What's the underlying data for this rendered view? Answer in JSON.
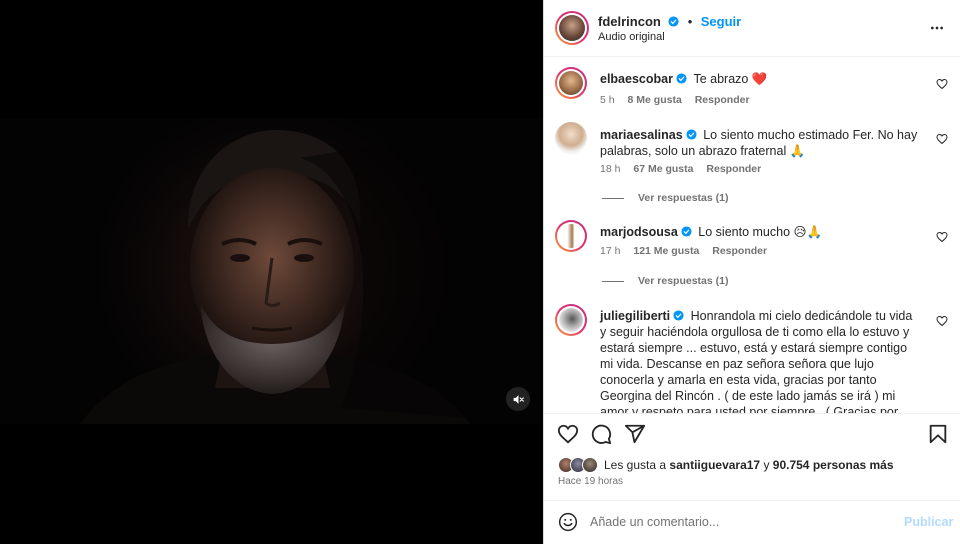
{
  "post": {
    "username": "fdelrincon",
    "separator": "•",
    "follow_label": "Seguir",
    "audio": "Audio original"
  },
  "comments": [
    {
      "username": "elbaescobar",
      "text": "Te abrazo ❤️",
      "time": "5 h",
      "likes": "8 Me gusta",
      "reply": "Responder"
    },
    {
      "username": "mariaesalinas",
      "text": "Lo siento mucho estimado Fer. No hay palabras, solo un abrazo fraternal 🙏",
      "time": "18 h",
      "likes": "67 Me gusta",
      "reply": "Responder",
      "view_replies": "Ver respuestas (1)"
    },
    {
      "username": "marjodsousa",
      "text": "Lo siento mucho 😥🙏",
      "time": "17 h",
      "likes": "121 Me gusta",
      "reply": "Responder",
      "view_replies": "Ver respuestas (1)"
    },
    {
      "username": "juliegiliberti",
      "text": "Honrandola mi cielo dedicándole tu vida y seguir haciéndola orgullosa de ti como ella lo estuvo y estará siempre ... estuvo, está y estará siempre contigo mi vida. Descanse en paz señora señora que lujo conocerla y amarla en esta vida, gracias por tanto Georgina del Rincón . ( de este lado jamás se irá ) mi amor y respeto para usted por siempre . ( Gracias por ese hijo maravailloso que me regaló , gracias por"
    }
  ],
  "likes_summary": {
    "prefix": "Les gusta a ",
    "user": "santiiguevara17",
    "middle": " y ",
    "count": "90.754 personas más"
  },
  "post_time": "Hace 19 horas",
  "add_comment": {
    "placeholder": "Añade un comentario...",
    "publish_label": "Publicar"
  },
  "icons": {
    "verified": "verified-badge-icon",
    "more": "more-options-icon",
    "like": "heart-icon",
    "comment": "comment-bubble-icon",
    "share": "paper-plane-icon",
    "save": "bookmark-icon",
    "emoji": "emoji-icon",
    "mute": "muted-speaker-icon"
  },
  "colors": {
    "accent": "#0095f6",
    "text": "#262626",
    "secondary": "#737373",
    "heart_red": "#ed4956",
    "publish_disabled": "#b3dbff"
  }
}
